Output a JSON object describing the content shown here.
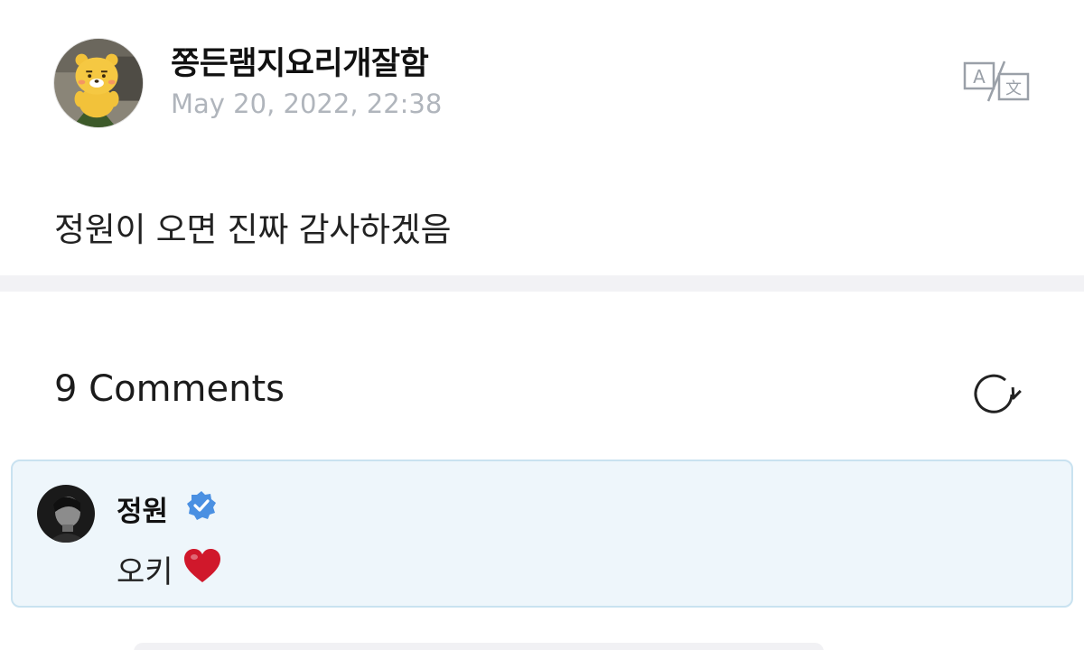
{
  "post": {
    "author": "쫑든램지요리개잘함",
    "date": "May 20, 2022, 22:38",
    "body": "정원이 오면 진짜 감사하겠음",
    "avatar_icon": "yellow-bear-plush-avatar",
    "translate_icon": "translate-icon"
  },
  "comments": {
    "count_label": "9 Comments",
    "refresh_icon": "refresh-icon",
    "items": [
      {
        "author": "정원",
        "verified": true,
        "text": "오키",
        "emoji_icon": "red-heart-icon",
        "highlight_bg": "#eef6fb",
        "highlight_border": "#c9e2f0"
      }
    ]
  },
  "colors": {
    "date_gray": "#b0b5bc",
    "verified_blue": "#4a90e2",
    "heart_red": "#d0182b"
  }
}
